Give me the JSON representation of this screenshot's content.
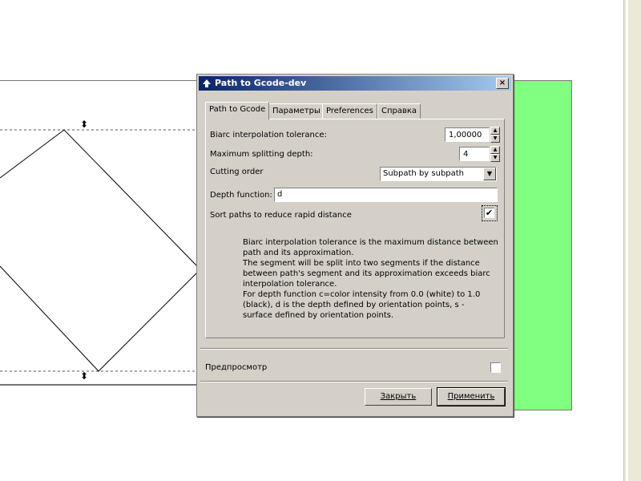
{
  "dialog": {
    "title": "Path to Gcode-dev",
    "close_glyph": "×",
    "tabs": [
      "Path to Gcode",
      "Параметры",
      "Preferences",
      "Справка"
    ],
    "fields": {
      "biarc_label": "Biarc interpolation tolerance:",
      "biarc_value": "1,00000",
      "depth_label": "Maximum splitting depth:",
      "depth_value": "4",
      "order_label": "Cutting order",
      "order_value": "Subpath by subpath",
      "depth_fn_label": "Depth function:",
      "depth_fn_value": "d",
      "sort_label": "Sort paths to reduce rapid distance",
      "sort_checked": "✔"
    },
    "description": [
      "Biarc interpolation tolerance is the maximum distance between",
      "path and its approximation.",
      "The segment will be split into two segments if the distance",
      "between path's segment and its approximation exceeds biarc",
      "interpolation tolerance.",
      "For depth function c=color intensity from 0.0 (white) to 1.0",
      "(black), d is the depth defined by orientation points, s -",
      "surface defined by orientation points."
    ],
    "preview_label": "Предпросмотр",
    "close_button": "Закрыть",
    "apply_button": "Применить"
  },
  "canvas": {
    "shape_fill": "#80ff80",
    "handle_glyph": "⬍"
  }
}
